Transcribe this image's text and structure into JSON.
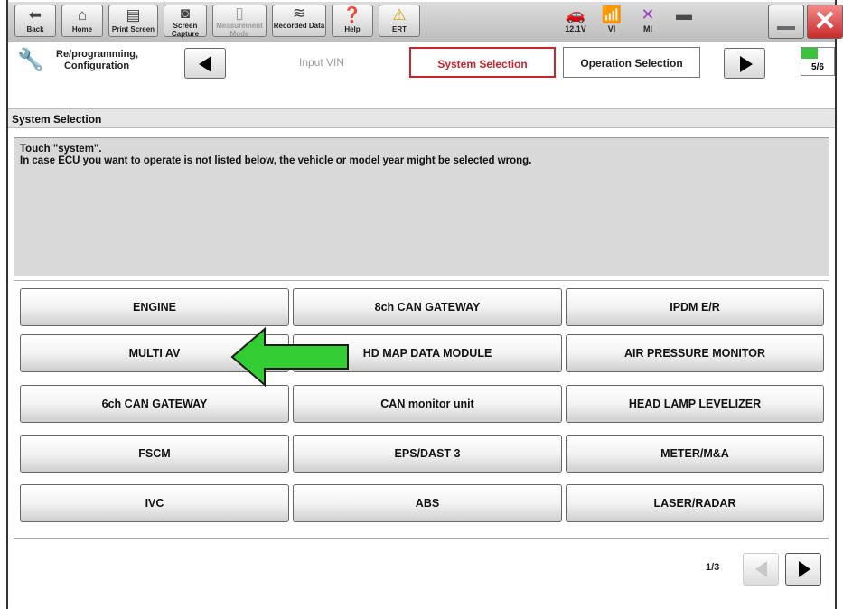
{
  "toolbar": {
    "buttons": [
      {
        "label": "Back",
        "icon": "back-arrow-icon"
      },
      {
        "label": "Home",
        "icon": "home-icon"
      },
      {
        "label": "Print Screen",
        "icon": "printer-icon"
      },
      {
        "label": "Screen Capture",
        "icon": "camera-icon"
      },
      {
        "label": "Measurement Mode",
        "icon": "measurement-icon"
      },
      {
        "label": "Recorded Data",
        "icon": "recorded-data-icon"
      },
      {
        "label": "Help",
        "icon": "help-icon"
      },
      {
        "label": "ERT",
        "icon": "warning-icon"
      }
    ],
    "status": [
      {
        "label": "12.1V",
        "icon": "car-battery-icon"
      },
      {
        "label": "VI",
        "icon": "signal-icon"
      },
      {
        "label": "MI",
        "icon": "x-icon"
      }
    ]
  },
  "breadcrumb": {
    "title": "Re/programming, Configuration",
    "steps": [
      "Input VIN",
      "System Selection",
      "Operation Selection"
    ],
    "progress_text": "5/6",
    "progress_fraction": 0.5
  },
  "section_title": "System Selection",
  "message": {
    "line1": "Touch \"system\".",
    "line2": "In case ECU you want to operate is not listed below, the vehicle or model year might be selected wrong."
  },
  "systems": [
    [
      "ENGINE",
      "8ch CAN GATEWAY",
      "IPDM E/R"
    ],
    [
      "MULTI AV",
      "HD MAP DATA MODULE",
      "AIR PRESSURE MONITOR"
    ],
    [
      "6ch CAN GATEWAY",
      "CAN monitor unit",
      "HEAD LAMP LEVELIZER"
    ],
    [
      "FSCM",
      "EPS/DAST 3",
      "METER/M&A"
    ],
    [
      "IVC",
      "ABS",
      "LASER/RADAR"
    ]
  ],
  "pagination": {
    "text": "1/3"
  },
  "colors": {
    "active_step": "#c9252f",
    "arrow_fill": "#33cc33",
    "progress_fill": "#3cc23c",
    "close_button": "#c92a2a"
  }
}
